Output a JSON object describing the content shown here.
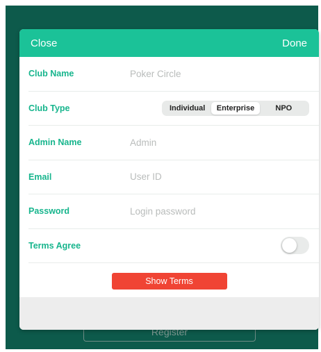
{
  "header": {
    "close_label": "Close",
    "done_label": "Done"
  },
  "form": {
    "club_name": {
      "label": "Club Name",
      "placeholder": "Poker Circle",
      "value": ""
    },
    "club_type": {
      "label": "Club Type",
      "options": [
        "Individual",
        "Enterprise",
        "NPO"
      ],
      "selected": "Enterprise"
    },
    "admin_name": {
      "label": "Admin Name",
      "placeholder": "Admin",
      "value": ""
    },
    "email": {
      "label": "Email",
      "placeholder": "User ID",
      "value": ""
    },
    "password": {
      "label": "Password",
      "placeholder": "Login password",
      "value": ""
    },
    "terms": {
      "label": "Terms Agree",
      "checked": false
    }
  },
  "show_terms_label": "Show Terms",
  "register_label": "Register",
  "colors": {
    "accent": "#1bc298",
    "label": "#17b58d",
    "backdrop": "#0d5a4b",
    "danger": "#f04434"
  }
}
